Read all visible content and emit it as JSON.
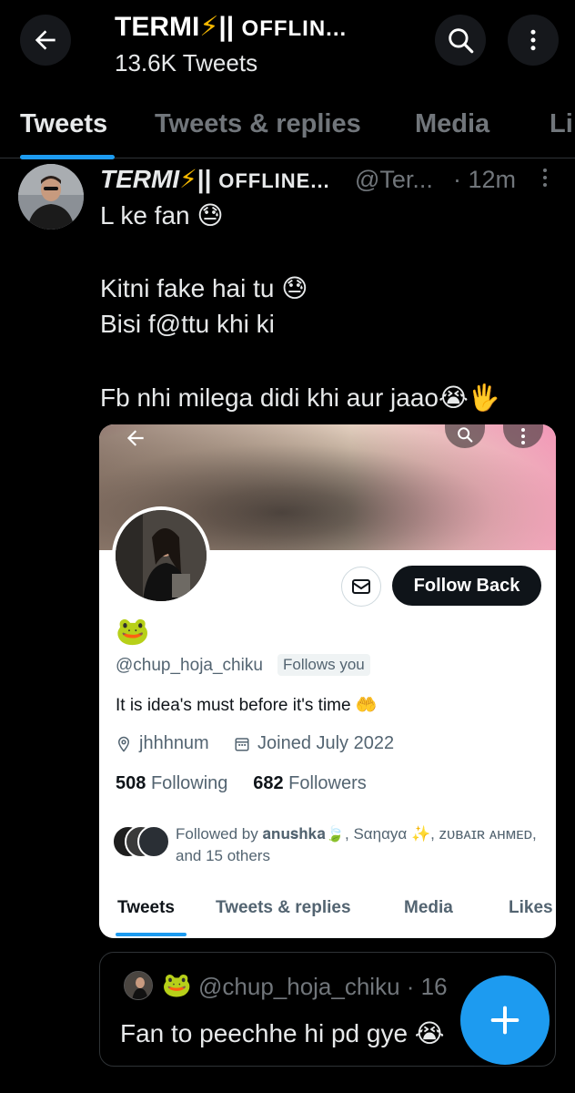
{
  "header": {
    "title_name": "TERMI",
    "title_bolt": "⚡",
    "title_rest": "|| ",
    "title_tag": "OFFLIN...",
    "subtitle": "13.6K Tweets"
  },
  "tabs": [
    "Tweets",
    "Tweets & replies",
    "Media",
    "Li"
  ],
  "tweet": {
    "name": "TERMI",
    "bolt": "⚡",
    "name_rest": "|| ",
    "name_tag": "OFFLINE...",
    "handle": "@Ter...",
    "time": "· 12m",
    "lines": [
      "L ke fan 😓",
      "Kitni fake hai tu 😓",
      "Bisi f@ttu khi ki",
      "Fb nhi milega didi khi aur jaao😭🖐"
    ]
  },
  "card": {
    "follow_button": "Follow Back",
    "emoji": "🐸",
    "handle": "@chup_hoja_chiku",
    "follows_you": "Follows you",
    "bio": "It is idea's must before it's time 🤲",
    "location": "jhhhnum",
    "joined": "Joined July 2022",
    "following_count": "508",
    "following_label": "Following",
    "followers_count": "682",
    "followers_label": "Followers",
    "followed_by": "Followed by 𝐚𝐧𝐮𝐬𝐡𝐤𝐚🍃, Sαηαуα ✨, ᴢᴜʙᴀɪʀ ᴀʜᴍᴇᴅ, and 15 others",
    "tabs": [
      "Tweets",
      "Tweets & replies",
      "Media",
      "Likes"
    ]
  },
  "quote": {
    "emoji": "🐸",
    "handle": "@chup_hoja_chiku · 16",
    "text": "Fan to peechhe hi pd gye 😭"
  },
  "colors": {
    "accent": "#1d9bf0",
    "background": "#000000",
    "secondary_text": "#71767b"
  }
}
